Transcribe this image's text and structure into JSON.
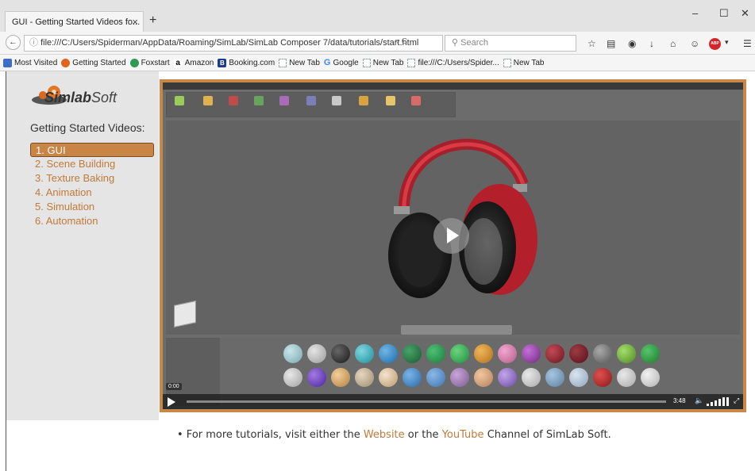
{
  "browser": {
    "tab_title": "GUI - Getting Started Videos fo...",
    "tab_close": "×",
    "new_tab": "+",
    "window_controls": {
      "minimize": "–",
      "maximize": "☐",
      "close": "✕"
    },
    "url": "file:///C:/Users/Spiderman/AppData/Roaming/SimLab/SimLab Composer 7/data/tutorials/start.html",
    "search_placeholder": "Search",
    "abp_label": "ABP",
    "bookmarks": [
      {
        "label": "Most Visited",
        "icon": "most-visited-icon"
      },
      {
        "label": "Getting Started",
        "icon": "firefox-icon"
      },
      {
        "label": "Foxstart",
        "icon": "globe-icon"
      },
      {
        "label": "Amazon",
        "icon": "amazon-icon"
      },
      {
        "label": "Booking.com",
        "icon": "booking-icon"
      },
      {
        "label": "New Tab",
        "icon": "blank-page-icon"
      },
      {
        "label": "Google",
        "icon": "google-icon"
      },
      {
        "label": "New Tab",
        "icon": "blank-page-icon"
      },
      {
        "label": "file:///C:/Users/Spider...",
        "icon": "blank-page-icon"
      },
      {
        "label": "New Tab",
        "icon": "blank-page-icon"
      }
    ]
  },
  "sidebar": {
    "logo_main": "Simlab",
    "logo_sub": "Soft",
    "heading": "Getting Started Videos:",
    "items": [
      {
        "label": "1. GUI",
        "active": true
      },
      {
        "label": "2. Scene Building",
        "active": false
      },
      {
        "label": "3. Texture Baking",
        "active": false
      },
      {
        "label": "4. Animation",
        "active": false
      },
      {
        "label": "5. Simulation",
        "active": false
      },
      {
        "label": "6. Automation",
        "active": false
      }
    ]
  },
  "video": {
    "current_time": "0:00",
    "duration": "3:48",
    "progress": 0.0,
    "volume": 1.0,
    "accent_color": "#c98848"
  },
  "footer": {
    "bullet": "•",
    "text_before": " For more tutorials, visit either the ",
    "link1": "Website",
    "text_middle": " or the ",
    "link2": "YouTube",
    "text_after": " Channel of SimLab Soft."
  },
  "colors": {
    "link": "#c07a3a",
    "active_item_bg": "#c88546",
    "sidebar_bg": "#e5e5e5"
  }
}
